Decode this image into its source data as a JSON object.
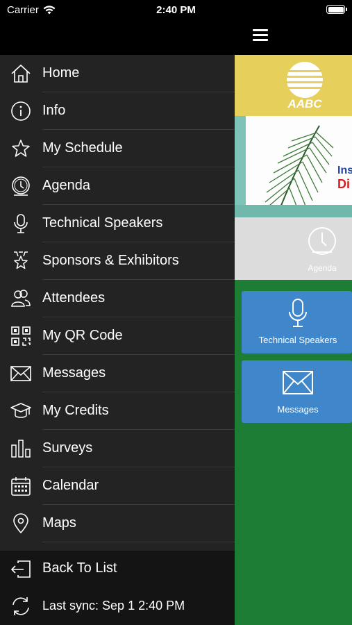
{
  "status_bar": {
    "carrier": "Carrier",
    "time": "2:40 PM"
  },
  "header": {
    "menu_icon": "hamburger-icon"
  },
  "drawer": {
    "items": [
      {
        "label": "Home",
        "icon": "home-icon"
      },
      {
        "label": "Info",
        "icon": "info-icon"
      },
      {
        "label": "My Schedule",
        "icon": "star-icon"
      },
      {
        "label": "Agenda",
        "icon": "clock-icon"
      },
      {
        "label": "Technical Speakers",
        "icon": "microphone-icon"
      },
      {
        "label": "Sponsors & Exhibitors",
        "icon": "sponsor-star-icon"
      },
      {
        "label": "Attendees",
        "icon": "people-icon"
      },
      {
        "label": "My QR Code",
        "icon": "qr-code-icon"
      },
      {
        "label": "Messages",
        "icon": "envelope-icon"
      },
      {
        "label": "My Credits",
        "icon": "graduation-cap-icon"
      },
      {
        "label": "Surveys",
        "icon": "bar-chart-icon"
      },
      {
        "label": "Calendar",
        "icon": "calendar-icon"
      },
      {
        "label": "Maps",
        "icon": "map-pin-icon"
      }
    ],
    "footer": {
      "back": {
        "label": "Back To List",
        "icon": "exit-icon"
      },
      "sync": {
        "label": "Last sync:  Sep 1 2:40 PM",
        "icon": "sync-icon"
      }
    }
  },
  "page": {
    "logo_text": "AABC",
    "banner_text_1": "Ins",
    "banner_text_2": "Di",
    "agenda_label": "Agenda",
    "tiles": [
      {
        "label": "Technical Speakers",
        "icon": "microphone-icon"
      },
      {
        "label": "Messages",
        "icon": "envelope-icon"
      }
    ]
  },
  "colors": {
    "drawer_bg": "#232323",
    "page_green": "#1e7d35",
    "banner_yellow": "#e6cf5a",
    "tile_blue": "#3f86cb"
  }
}
